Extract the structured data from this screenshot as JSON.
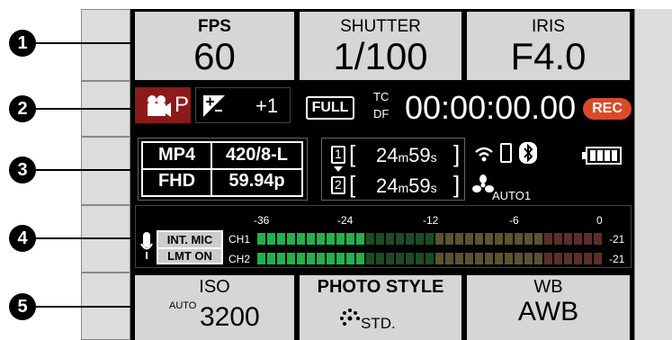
{
  "callouts": [
    "1",
    "2",
    "3",
    "4",
    "5"
  ],
  "top": {
    "fps": {
      "label": "FPS",
      "value": "60"
    },
    "shutter": {
      "label": "SHUTTER",
      "value": "1/100"
    },
    "iris": {
      "label": "IRIS",
      "value": "F4.0"
    }
  },
  "row2": {
    "mode_letter": "P",
    "exposure_comp": "+1",
    "full_label": "FULL",
    "tc_top": "TC",
    "tc_bottom": "DF",
    "timecode": "00:00:00.00",
    "rec_label": "REC"
  },
  "row3": {
    "format": "MP4",
    "sampling": "420/8-L",
    "resolution": "FHD",
    "framerate": "59.94p",
    "card1": {
      "slot": "1",
      "time_min": "24",
      "unit_m": "m",
      "time_sec": "59",
      "unit_s": "s"
    },
    "card2": {
      "slot": "2",
      "time_min": "24",
      "unit_m": "m",
      "time_sec": "59",
      "unit_s": "s"
    },
    "fan_label": "AUTO1"
  },
  "row4": {
    "mic_top": "INT. MIC",
    "mic_bottom": "LMT ON",
    "scale": [
      "-36",
      "-24",
      "-12",
      "-6",
      "0"
    ],
    "ch1_label": "CH1",
    "ch2_label": "CH2",
    "ch1_peak": "-21",
    "ch2_peak": "-21",
    "ch1_level_segments": 11,
    "ch2_level_segments": 11,
    "total_segments": 35
  },
  "bottom": {
    "iso": {
      "label": "ISO",
      "prefix": "AUTO",
      "value": "3200"
    },
    "photo_style": {
      "label": "PHOTO STYLE",
      "value": "STD."
    },
    "wb": {
      "label": "WB",
      "value": "AWB"
    }
  },
  "colors": {
    "tile_bg": "#d6d6d6",
    "screen_bg": "#000000",
    "mode_bg": "#8b1a1a",
    "rec_bg": "#d94a2b",
    "meter_green": "#22b14c",
    "meter_dim_green": "#1d4a24",
    "meter_dim_yellow": "#5a5230",
    "meter_dim_red": "#5a2f2a"
  }
}
